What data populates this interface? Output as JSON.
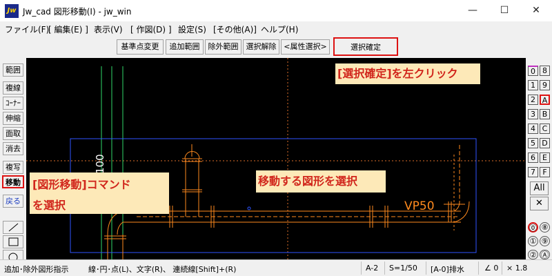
{
  "window": {
    "title": "Jw_cad 図形移動(I) - jw_win",
    "app_icon_text": "Jw",
    "controls": {
      "minimize": "—",
      "maximize": "☐",
      "close": "✕"
    }
  },
  "menu": [
    "ファイル(F)",
    "[ 編集(E) ]",
    "表示(V)",
    "[ 作図(D) ]",
    "設定(S)",
    "[その他(A)]",
    "ヘルプ(H)"
  ],
  "toolbar": {
    "buttons": [
      "基準点変更",
      "追加範囲",
      "除外範囲",
      "選択解除",
      "<属性選択>"
    ],
    "confirm": "選択確定"
  },
  "left_palette": {
    "buttons": [
      "範囲",
      "複線",
      "ｺｰﾅｰ",
      "伸縮",
      "面取",
      "消去",
      "複写",
      "移動",
      "戻る"
    ],
    "active": "移動",
    "shapes": [
      "line-tool",
      "rectangle-tool",
      "circle-tool"
    ]
  },
  "right_palette": {
    "layer_groups": [
      "0",
      "1",
      "2",
      "3",
      "4",
      "5",
      "6",
      "7"
    ],
    "layers": [
      "8",
      "9",
      "A",
      "B",
      "C",
      "D",
      "E",
      "F"
    ],
    "all_label": "All",
    "x_label": "✕",
    "circled": [
      "⓪",
      "⑧",
      "①",
      "⑨",
      "②",
      "Ⓐ"
    ]
  },
  "canvas": {
    "dimension_label": "100",
    "pipe_label": "VP50",
    "callouts": {
      "confirm": "[選択確定]を左クリック",
      "command_line1": "[図形移動]コマンド",
      "command_line2": "を選択",
      "select_shape": "移動する図形を選択"
    },
    "colors": {
      "background": "#000000",
      "pipe": "#ff8a1e",
      "selection": "#2f55ff",
      "guide": "#30d96a",
      "callout_bg": "#fde9b8",
      "callout_text": "#d1261c"
    }
  },
  "status": {
    "hint": "追加･除外図形指示",
    "guide": "線･円･点(L)、文字(R)、 連続線[Shift]+(R)",
    "scale_id": "A-2",
    "scale": "S=1/50",
    "layer": "[A-0]排水",
    "angle": "∠ 0",
    "zoom": "× 1.8"
  }
}
